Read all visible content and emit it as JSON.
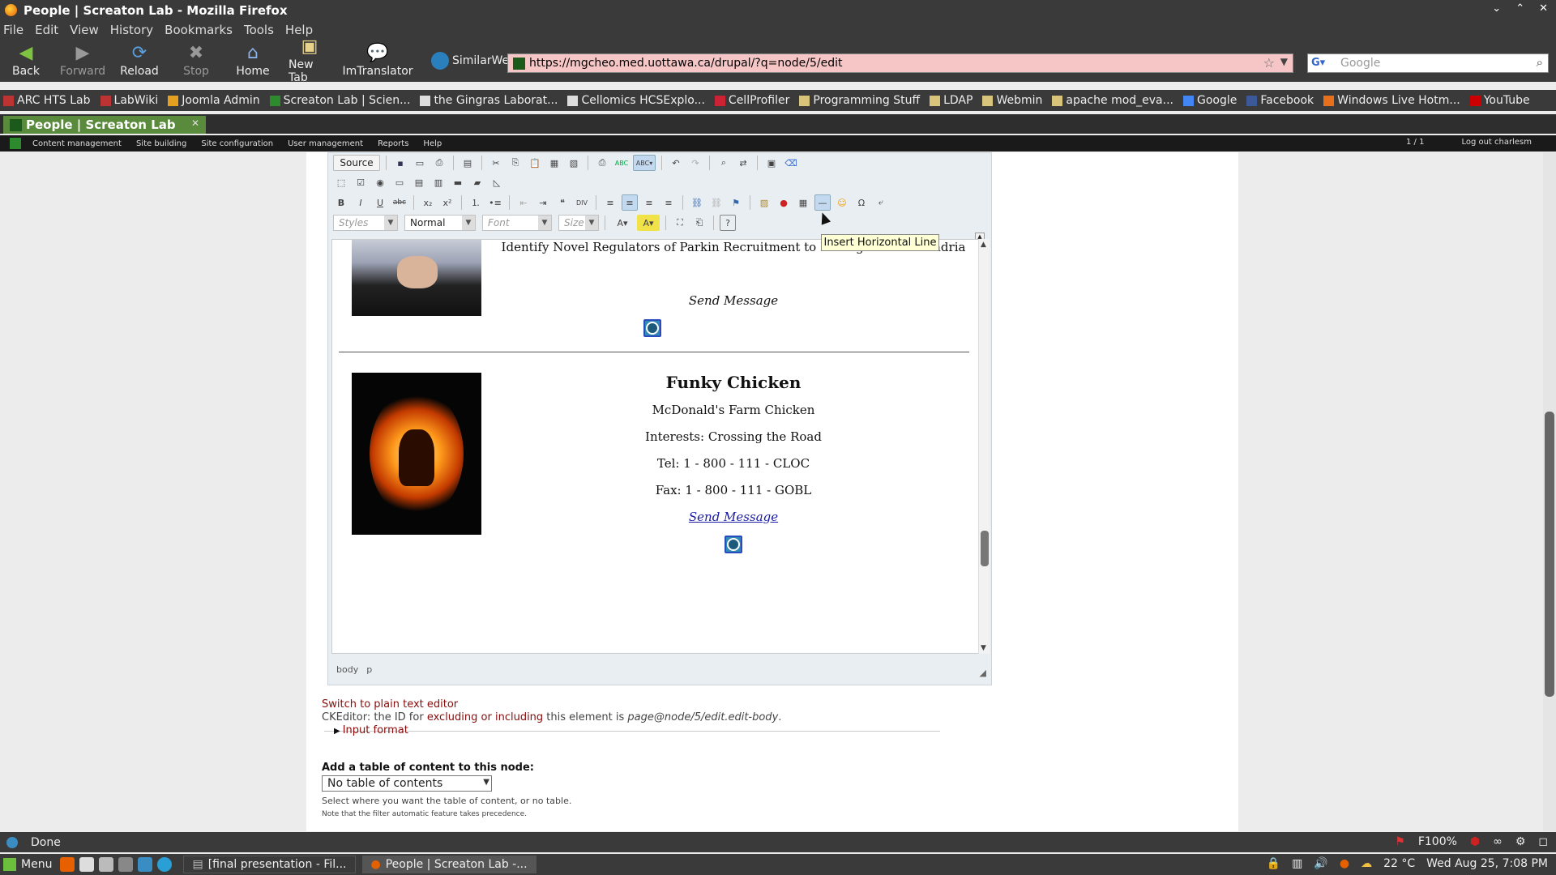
{
  "window": {
    "title": "People | Screaton Lab - Mozilla Firefox"
  },
  "menu": [
    "File",
    "Edit",
    "View",
    "History",
    "Bookmarks",
    "Tools",
    "Help"
  ],
  "nav": {
    "back": "Back",
    "forward": "Forward",
    "reload": "Reload",
    "stop": "Stop",
    "home": "Home",
    "new_tab": "New Tab",
    "imtranslator": "ImTranslator",
    "similarweb": "SimilarWeb"
  },
  "url": "https://mgcheo.med.uottawa.ca/drupal/?q=node/5/edit",
  "search": {
    "placeholder": "Google"
  },
  "bookmarks": [
    "ARC HTS Lab",
    "LabWiki",
    "Joomla Admin",
    "Screaton Lab | Scien...",
    "the Gingras Laborat...",
    "Cellomics HCSExplo...",
    "CellProfiler",
    "Programming Stuff",
    "LDAP",
    "Webmin",
    "apache mod_eva...",
    "Google",
    "Facebook",
    "Windows Live Hotm...",
    "YouTube"
  ],
  "tab": {
    "label": "People | Screaton Lab"
  },
  "admin": {
    "items": [
      "Content management",
      "Site building",
      "Site configuration",
      "User management",
      "Reports",
      "Help"
    ],
    "page_count": "1 / 1",
    "logout": "Log out charlesm"
  },
  "editor": {
    "source_label": "Source",
    "styles": "Styles",
    "format": "Normal",
    "font": "Font",
    "size": "Size",
    "tooltip": "Insert Horizontal Line",
    "path": {
      "body": "body",
      "p": "p"
    },
    "content": {
      "project_line": "Identify Novel Regulators of Parkin Recruitment to Damaged Mitochondria",
      "send_message_1": "Send Message",
      "person2": {
        "name": "Funky Chicken",
        "title": "McDonald's Farm Chicken",
        "interests": "Interests: Crossing the Road",
        "tel": "Tel: 1 - 800 - 111 - CLOC",
        "fax": "Fax: 1 - 800 - 111 - GOBL",
        "send_message": "Send Message"
      }
    }
  },
  "below": {
    "switch_plain": "Switch to plain text editor",
    "ck_prefix": "CKEditor: the ID for ",
    "ck_link": "excluding or including",
    "ck_mid": " this element is ",
    "ck_id": "page@node/5/edit.edit-body",
    "ck_end": ".",
    "input_format": "Input format",
    "toc_label": "Add a table of content to this node:",
    "toc_value": "No table of contents",
    "toc_desc1": "Select where you want the table of content, or no table.",
    "toc_desc2": "Note that the filter automatic feature takes precedence."
  },
  "statusbar": {
    "text": "Done",
    "zoom": "F100%"
  },
  "taskbar": {
    "menu": "Menu",
    "task1": "[final presentation - Fil...",
    "task2": "People | Screaton Lab -...",
    "weather": "22 °C",
    "datetime": "Wed Aug 25, 7:08 PM"
  },
  "colors": {
    "accent_link": "#8a0b0b",
    "url_bg": "#f6c6c6",
    "tab_bg": "#5a8a3c"
  }
}
